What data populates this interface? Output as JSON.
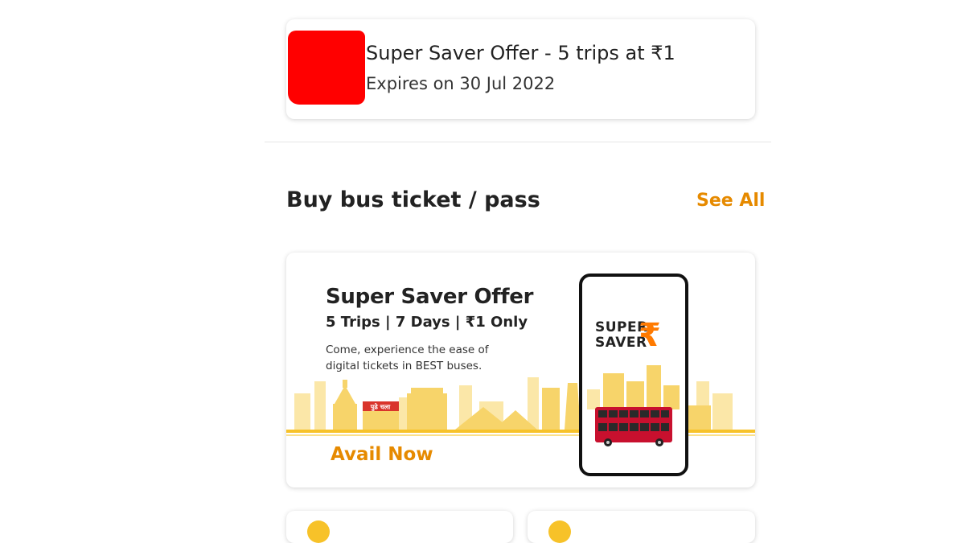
{
  "offer_card": {
    "title": "Super Saver Offer - 5 trips at ₹1",
    "expiry": "Expires on 30 Jul 2022"
  },
  "section": {
    "title": "Buy bus ticket / pass",
    "see_all": "See All"
  },
  "banner": {
    "headline": "Super Saver Offer",
    "subline": "5 Trips | 7 Days | ₹1 Only",
    "description": "Come, experience the ease of digital tickets in BEST buses.",
    "cta": "Avail Now",
    "logo_line1": "SUPER",
    "logo_line2": "SAVER",
    "logo_symbol": "₹",
    "sign_text": "पुढे चला"
  },
  "colors": {
    "accent": "#e68a00",
    "redaction": "#ff0000",
    "bus": "#c8102e",
    "skyline": "#f7d46a"
  }
}
